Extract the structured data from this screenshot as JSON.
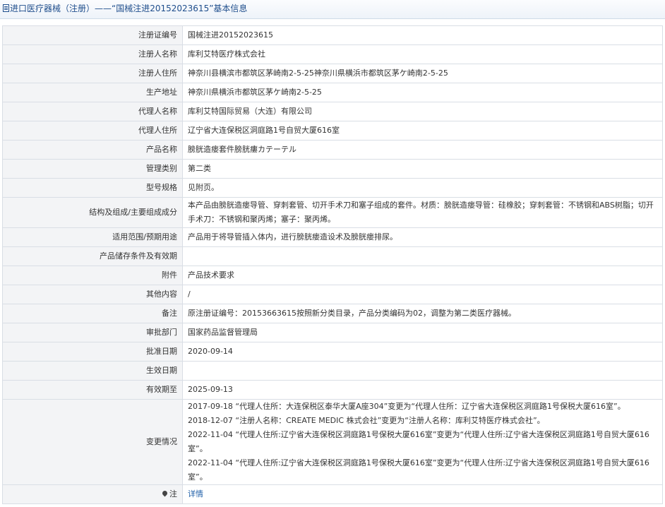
{
  "header": {
    "prefix": "进口医疗器械（注册）——“国械注进20152023615”基本信息"
  },
  "icons": {
    "header_icon": "document-icon",
    "note_icon": "location-pin-icon"
  },
  "colors": {
    "header_text": "#1f4e8c",
    "label_bg": "#f3f4f6",
    "border": "#d9dee5",
    "link": "#1f5fa8"
  },
  "rows": {
    "reg_no": {
      "label": "注册证编号",
      "value": "国械注进20152023615"
    },
    "registrant_name": {
      "label": "注册人名称",
      "value": "库利艾特医疗株式会社"
    },
    "registrant_address": {
      "label": "注册人住所",
      "value": "神奈川县横滨市都筑区茅崎南2-5-25神奈川県横浜市都筑区茅ケ崎南2-5-25"
    },
    "production_address": {
      "label": "生产地址",
      "value": "神奈川県横浜市都筑区茅ケ崎南2-5-25"
    },
    "agent_name": {
      "label": "代理人名称",
      "value": "库利艾特国际贸易（大连）有限公司"
    },
    "agent_address": {
      "label": "代理人住所",
      "value": "辽宁省大连保税区洞庭路1号自贸大厦616室"
    },
    "product_name": {
      "label": "产品名称",
      "value": "膀胱造瘘套件膀胱瘻カテーテル"
    },
    "category": {
      "label": "管理类别",
      "value": "第二类"
    },
    "model": {
      "label": "型号规格",
      "value": "见附页。"
    },
    "structure": {
      "label": "结构及组成/主要组成成分",
      "value": "本产品由膀胱造瘘导管、穿刺套管、切开手术刀和塞子组成的套件。材质：膀胱造瘘导管：硅橡胶；穿刺套管：不锈钢和ABS树脂；切开手术刀：不锈钢和聚丙烯；塞子：聚丙烯。"
    },
    "scope": {
      "label": "适用范围/预期用途",
      "value": "产品用于将导管插入体内，进行膀胱瘘造设术及膀胱瘘排尿。"
    },
    "storage": {
      "label": "产品储存条件及有效期",
      "value": ""
    },
    "attachment": {
      "label": "附件",
      "value": "产品技术要求"
    },
    "other": {
      "label": "其他内容",
      "value": "/"
    },
    "remark": {
      "label": "备注",
      "value": "原注册证编号：20153663615按照新分类目录，产品分类编码为02，调整为第二类医疗器械。"
    },
    "approval_dept": {
      "label": "审批部门",
      "value": "国家药品监督管理局"
    },
    "approval_date": {
      "label": "批准日期",
      "value": "2020-09-14"
    },
    "effective_date": {
      "label": "生效日期",
      "value": ""
    },
    "expiry_date": {
      "label": "有效期至",
      "value": "2025-09-13"
    },
    "changes": {
      "label": "变更情况",
      "entries": [
        "2017-09-18 “代理人住所：大连保税区泰华大厦A座304”变更为“代理人住所：辽宁省大连保税区洞庭路1号保税大厦616室”。",
        "2018-12-07 “注册人名称：CREATE MEDIC 株式会社”变更为“注册人名称：库利艾特医疗株式会社”。",
        "2022-11-04 “代理人住所:辽宁省大连保税区洞庭路1号保税大厦616室”变更为“代理人住所:辽宁省大连保税区洞庭路1号自贸大厦616室”。",
        "2022-11-04 “代理人住所:辽宁省大连保税区洞庭路1号保税大厦616室”变更为“代理人住所:辽宁省大连保税区洞庭路1号自贸大厦616室”。"
      ]
    },
    "note": {
      "label": "注",
      "link": "详情"
    }
  }
}
